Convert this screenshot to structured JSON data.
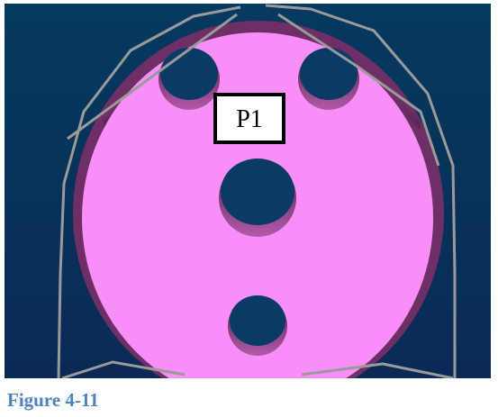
{
  "viewport": {
    "label": "P1"
  },
  "caption": "Figure 4-11",
  "colors": {
    "background_top": "#063a60",
    "background_bottom": "#0a2a55",
    "disc_fill": "#f88ef8",
    "disc_rim": "#7c3a70",
    "hole_fill": "#0a3a66",
    "hole_wall": "#8a3f80",
    "wire": "#9a9a9a",
    "label_border": "#000000",
    "label_fill": "#ffffff",
    "caption": "#4f81bd"
  }
}
